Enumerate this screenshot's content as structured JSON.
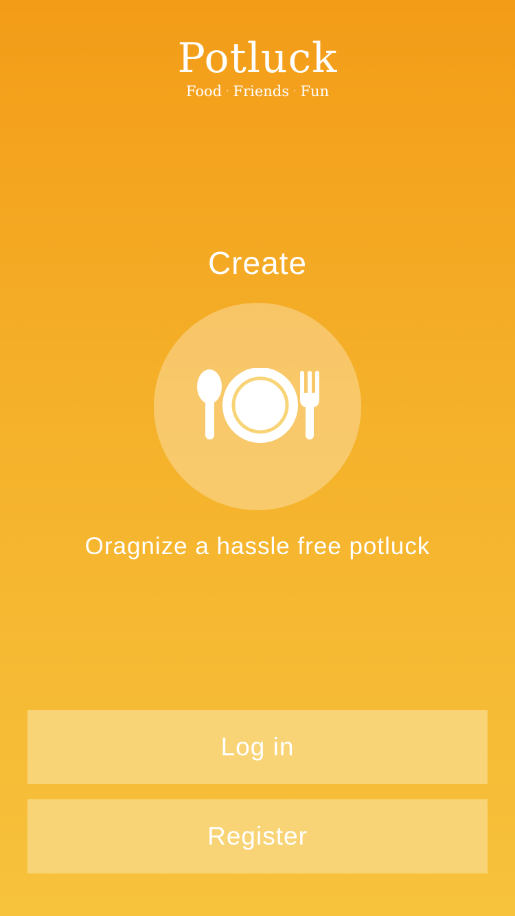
{
  "app": {
    "title": "Potluck",
    "tagline": [
      "Food",
      "Friends",
      "Fun"
    ],
    "tagline_separator": "·"
  },
  "feature": {
    "title": "Create",
    "icon": "plate-with-spoon-and-fork-icon",
    "description": "Oragnize a hassle free potluck"
  },
  "actions": {
    "login_label": "Log in",
    "register_label": "Register"
  },
  "colors": {
    "gradient_top": "#f39c18",
    "gradient_bottom": "#f7c23c",
    "button_background": "#f8d477",
    "text": "#ffffff"
  }
}
